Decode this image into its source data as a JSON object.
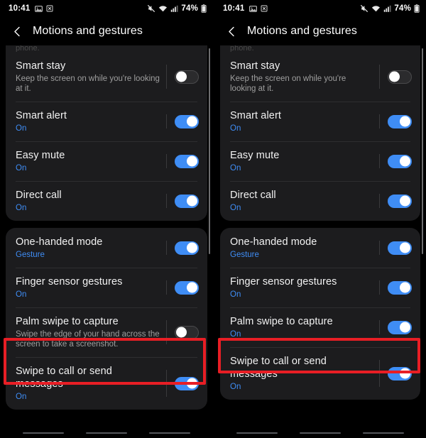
{
  "status_bar": {
    "time": "10:41",
    "left_icons": [
      "image-icon",
      "screenshot-icon"
    ],
    "right_icons": [
      "mute-icon",
      "wifi-icon",
      "signal-icon"
    ],
    "battery_percent": "74%"
  },
  "app_bar": {
    "back_icon": "chevron-left-icon",
    "title": "Motions and gestures"
  },
  "panels": [
    {
      "id": "before",
      "partial_text": "phone.",
      "groups": [
        {
          "clipped_top": true,
          "rows": [
            {
              "title": "Smart stay",
              "subtitle": "Keep the screen on while you're looking at it.",
              "subtitle_accent": false,
              "toggle": "off"
            },
            {
              "title": "Smart alert",
              "subtitle": "On",
              "subtitle_accent": true,
              "toggle": "on"
            },
            {
              "title": "Easy mute",
              "subtitle": "On",
              "subtitle_accent": true,
              "toggle": "on"
            },
            {
              "title": "Direct call",
              "subtitle": "On",
              "subtitle_accent": true,
              "toggle": "on"
            }
          ]
        },
        {
          "clipped_top": false,
          "rows": [
            {
              "title": "One-handed mode",
              "subtitle": "Gesture",
              "subtitle_accent": true,
              "toggle": "on"
            },
            {
              "title": "Finger sensor gestures",
              "subtitle": "On",
              "subtitle_accent": true,
              "toggle": "on"
            },
            {
              "title": "Palm swipe to capture",
              "subtitle": "Swipe the edge of your hand across the screen to take a screenshot.",
              "subtitle_accent": false,
              "toggle": "off",
              "highlighted": true
            },
            {
              "title": "Swipe to call or send messages",
              "subtitle": "On",
              "subtitle_accent": true,
              "toggle": "on"
            }
          ]
        }
      ]
    },
    {
      "id": "after",
      "partial_text": "phone.",
      "groups": [
        {
          "clipped_top": true,
          "rows": [
            {
              "title": "Smart stay",
              "subtitle": "Keep the screen on while you're looking at it.",
              "subtitle_accent": false,
              "toggle": "off"
            },
            {
              "title": "Smart alert",
              "subtitle": "On",
              "subtitle_accent": true,
              "toggle": "on"
            },
            {
              "title": "Easy mute",
              "subtitle": "On",
              "subtitle_accent": true,
              "toggle": "on"
            },
            {
              "title": "Direct call",
              "subtitle": "On",
              "subtitle_accent": true,
              "toggle": "on"
            }
          ]
        },
        {
          "clipped_top": false,
          "rows": [
            {
              "title": "One-handed mode",
              "subtitle": "Gesture",
              "subtitle_accent": true,
              "toggle": "on"
            },
            {
              "title": "Finger sensor gestures",
              "subtitle": "On",
              "subtitle_accent": true,
              "toggle": "on"
            },
            {
              "title": "Palm swipe to capture",
              "subtitle": "On",
              "subtitle_accent": true,
              "toggle": "on",
              "highlighted": true
            },
            {
              "title": "Swipe to call or send messages",
              "subtitle": "On",
              "subtitle_accent": true,
              "toggle": "on"
            }
          ]
        }
      ]
    }
  ],
  "colors": {
    "accent_blue": "#3f8df5",
    "highlight_red": "#e81e25",
    "card_bg": "#1c1c1e",
    "screen_bg": "#000000"
  },
  "nav_bar": {
    "hints": 3
  }
}
